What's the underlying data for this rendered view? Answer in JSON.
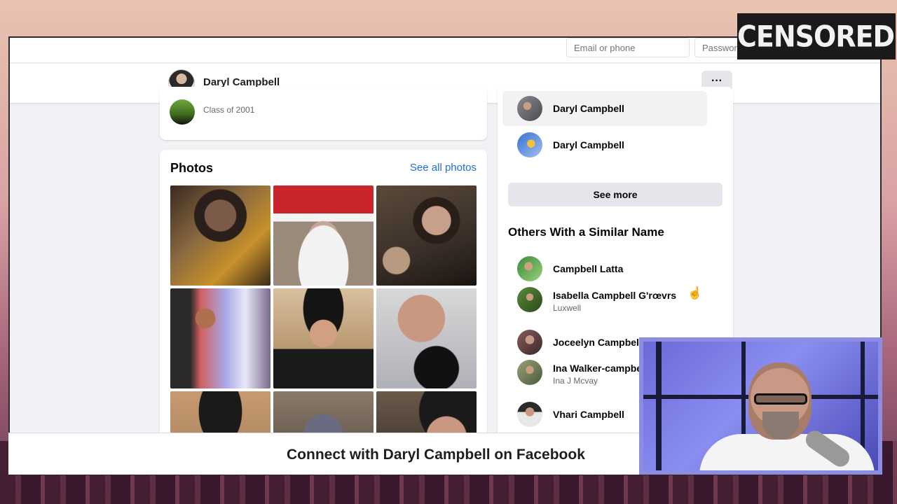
{
  "login": {
    "email_placeholder": "Email or phone",
    "password_placeholder": "Password"
  },
  "profile": {
    "name": "Daryl Campbell",
    "more_label": "···"
  },
  "education": {
    "detail": "Class of 2001"
  },
  "photos": {
    "title": "Photos",
    "see_all": "See all photos",
    "items": [
      {
        "desc": "man in fedora and sunglasses"
      },
      {
        "desc": "santa claus costume"
      },
      {
        "desc": "two young men"
      },
      {
        "desc": "man playing guitar"
      },
      {
        "desc": "man in hat with glasses"
      },
      {
        "desc": "man with sunglasses and microphone"
      },
      {
        "desc": "man in hat"
      },
      {
        "desc": "person in beanie"
      },
      {
        "desc": "man in hat"
      }
    ]
  },
  "same_name": {
    "people": [
      {
        "name": "Daryl Campbell"
      },
      {
        "name": "Daryl Campbell"
      }
    ],
    "see_more": "See more"
  },
  "similar": {
    "title": "Others With a Similar Name",
    "people": [
      {
        "name": "Campbell Latta",
        "sub": ""
      },
      {
        "name": "Isabella Campbell G'rœvrs",
        "sub": "Luxwell"
      },
      {
        "name": "Joceelyn Campbell",
        "sub": ""
      },
      {
        "name": "Ina Walker-campbe",
        "sub": "Ina J Mcvay"
      },
      {
        "name": "Vhari Campbell",
        "sub": ""
      }
    ]
  },
  "connect": {
    "text": "Connect with Daryl Campbell on Facebook"
  },
  "overlay": {
    "logo_text": "CENSORED.TV"
  }
}
